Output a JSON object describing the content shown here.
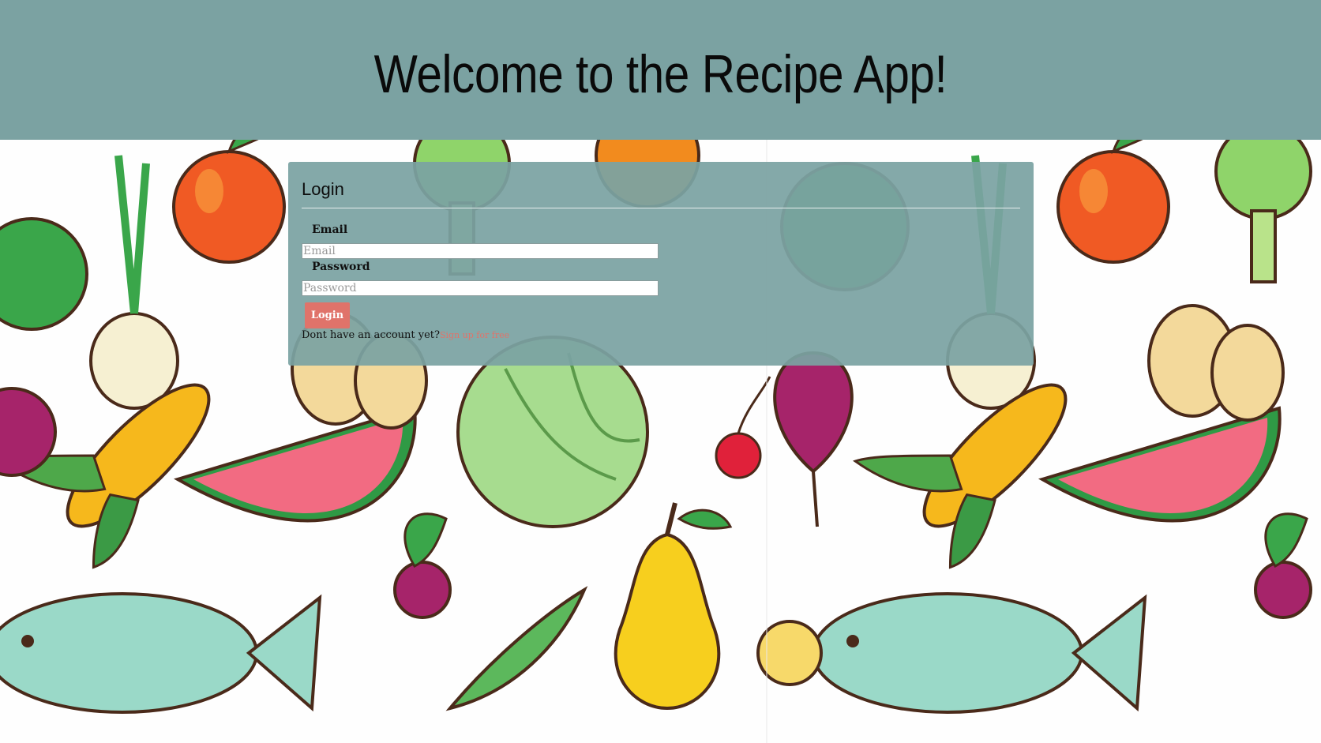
{
  "header": {
    "title": "Welcome to the Recipe App!"
  },
  "login": {
    "title": "Login",
    "email_label": "Email",
    "email_placeholder": "Email",
    "email_value": "",
    "password_label": "Password",
    "password_placeholder": "Password",
    "password_value": "",
    "button_label": "Login",
    "signup_prompt": "Dont have an account yet?",
    "signup_link": "Sign up for free"
  },
  "colors": {
    "header_bg": "#7ba2a2",
    "card_bg": "#7ba2a2",
    "accent": "#e0736a"
  },
  "background": {
    "illustration": [
      "apple-icon",
      "onion-icon",
      "corn-icon",
      "watermelon-icon",
      "cabbage-icon",
      "fish-icon",
      "pear-icon",
      "beet-icon",
      "eggs-icon",
      "broccoli-icon",
      "cherry-icon",
      "radish-icon",
      "peas-icon",
      "lemon-icon",
      "pepper-icon"
    ]
  }
}
